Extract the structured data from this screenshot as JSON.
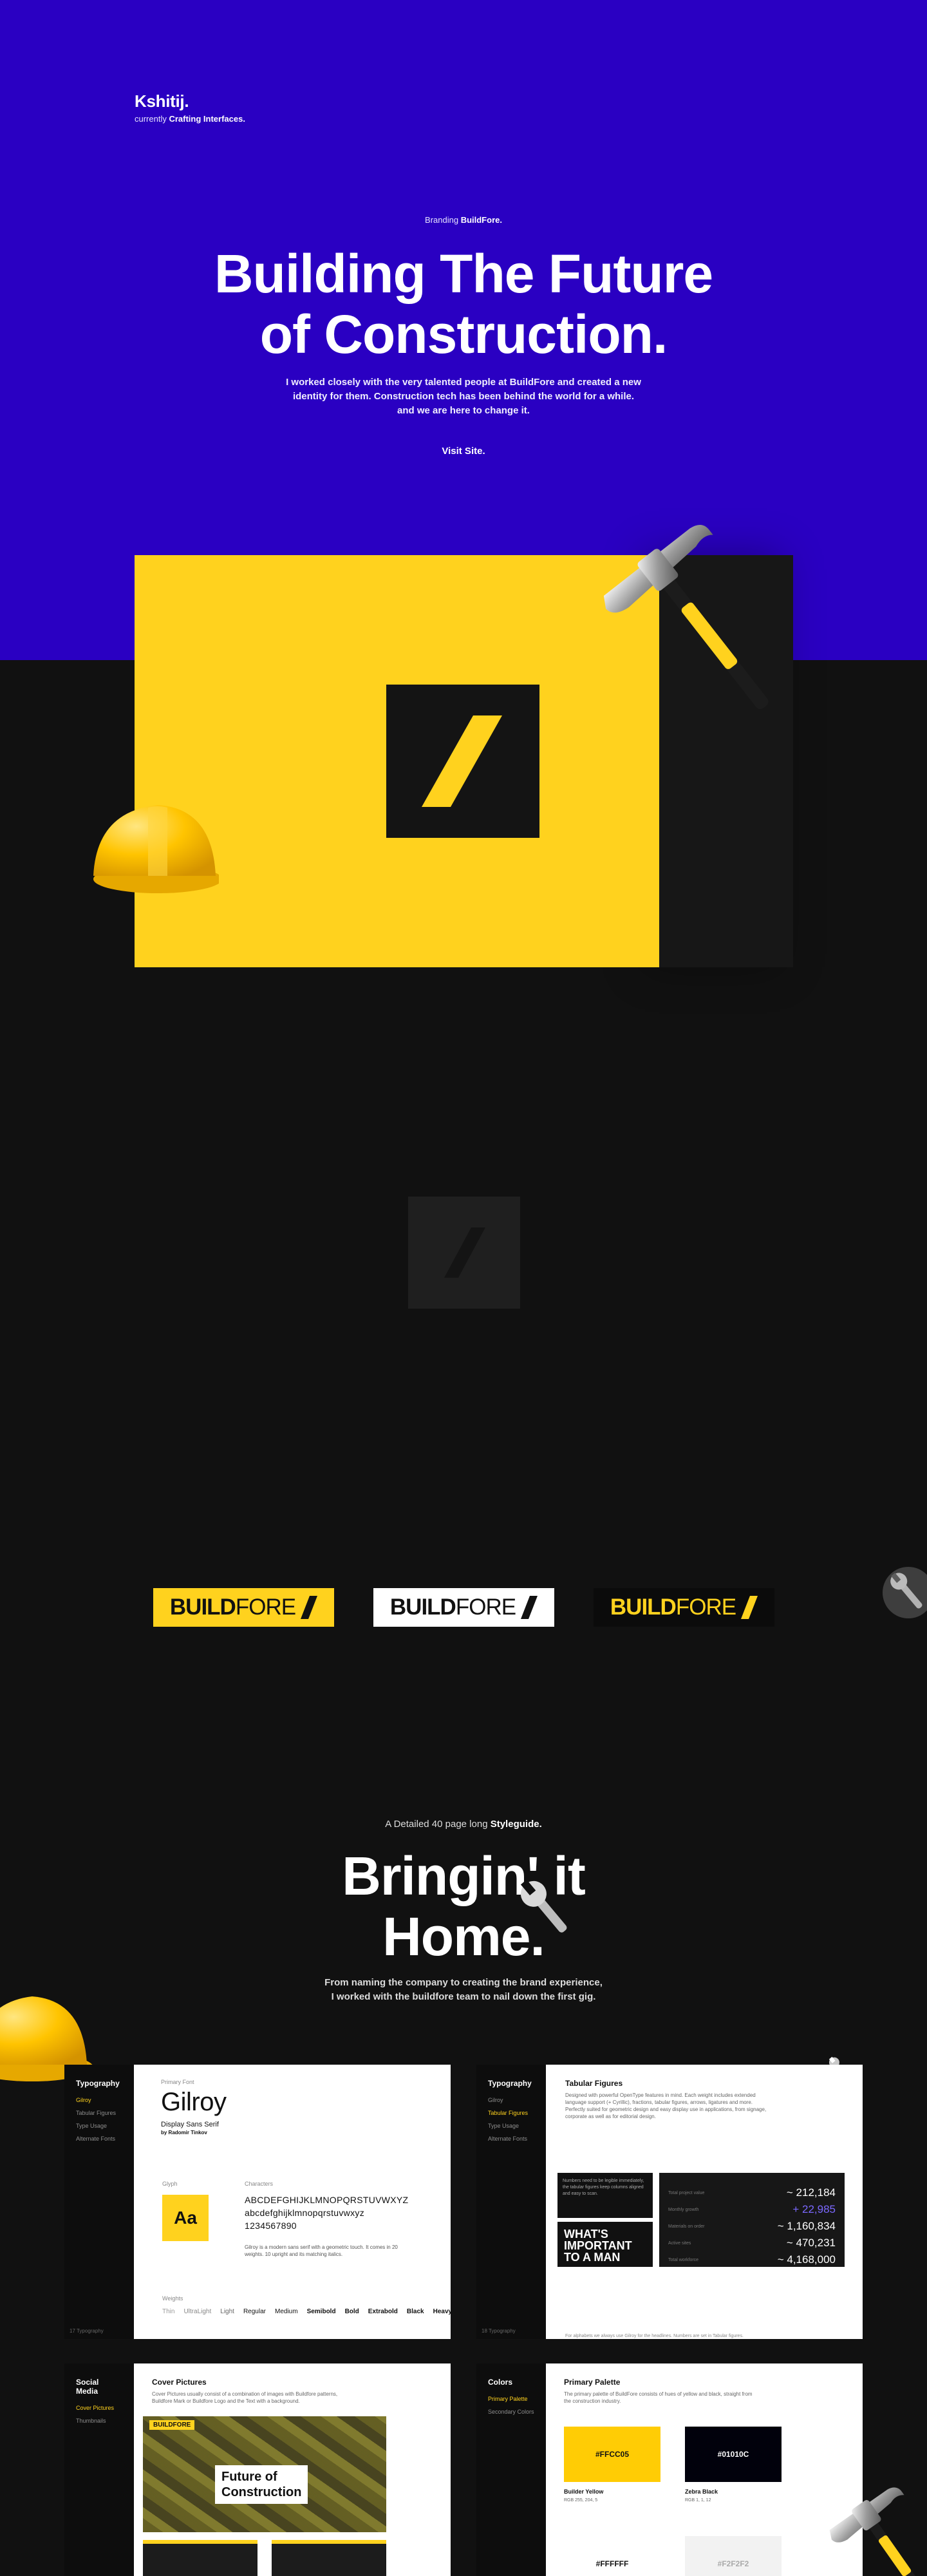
{
  "header": {
    "brand": "Kshitij.",
    "tagline_prefix": "currently ",
    "tagline_bold": "Crafting Interfaces."
  },
  "hero": {
    "eyebrow_prefix": "Branding ",
    "eyebrow_bold": "BuildFore.",
    "title_line1": "Building The Future",
    "title_line2": "of Construction.",
    "desc_line1": "I worked closely with the very talented people at BuildFore and created a new",
    "desc_line2": "identity for them. Construction tech has been behind the world for a while.",
    "desc_line3": "and we are here to change it.",
    "visit": "Visit Site."
  },
  "logos": {
    "word_bold": "BUILD",
    "word_light": "FORE"
  },
  "styleguide": {
    "eyebrow_prefix": "A Detailed 40 page long ",
    "eyebrow_bold": "Styleguide.",
    "title_line1": "Bringin' it",
    "title_line2": "Home.",
    "desc_line1": "From naming the company to creating the brand experience,",
    "desc_line2": "I worked with the buildfore team to nail down the first gig."
  },
  "card_typography": {
    "side_title": "Typography",
    "side_items": [
      "Gilroy",
      "Tabular Figures",
      "Type Usage",
      "Alternate Fonts"
    ],
    "foot": "17 Typography",
    "primary_font_label": "Primary Font",
    "font_name": "Gilroy",
    "font_desc": "Display Sans Serif",
    "font_author": "by Radomir Tinkov",
    "glyph_label": "Glyph",
    "glyph": "Aa",
    "chars_label": "Characters",
    "chars_upper": "ABCDEFGHIJKLMNOPQRSTUVWXYZ",
    "chars_lower": "abcdefghijklmnopqrstuvwxyz",
    "chars_num": "1234567890",
    "char_note": "Gilroy is a modern sans serif with a geometric touch. It comes in 20 weights. 10 upright and its matching italics.",
    "weights_label": "Weights",
    "weights": [
      "Thin",
      "UltraLight",
      "Light",
      "Regular",
      "Medium",
      "Semibold",
      "Bold",
      "Extrabold",
      "Black",
      "Heavy"
    ]
  },
  "card_tabular": {
    "side_title": "Typography",
    "side_items": [
      "Gilroy",
      "Tabular Figures",
      "Type Usage",
      "Alternate Fonts"
    ],
    "foot": "18 Typography",
    "title": "Tabular Figures",
    "text": "Designed with powerful OpenType features in mind. Each weight includes extended language support (+ Cyrillic), fractions, tabular figures, arrows, ligatures and more. Perfectly suited for geometric design and easy display use in applications, from signage, corporate as well as for editorial design.",
    "box1_text": "Numbers need to be legible immediately, the tabular figures keep columns aligned and easy to scan.",
    "box2_line1": "WHAT'S",
    "box2_line2": "IMPORTANT",
    "box2_line3": "TO A MAN",
    "rows": [
      {
        "label": "Total project value",
        "value": "~ 212,184"
      },
      {
        "label": "Monthly growth",
        "value": "+ 22,985"
      },
      {
        "label": "Materials on order",
        "value": "~ 1,160,834"
      },
      {
        "label": "Active sites",
        "value": "~ 470,231"
      },
      {
        "label": "Total workforce",
        "value": "~ 4,168,000"
      }
    ],
    "foot_note": "For alphabets we always use Gilroy for the headlines. Numbers are set in Tabular figures."
  },
  "card_social": {
    "side_title": "Social Media",
    "side_items": [
      "Cover Pictures",
      "Thumbnails"
    ],
    "title": "Cover Pictures",
    "text": "Cover Pictures usually consist of a combination of images with Buildfore patterns, Buildfore Mark or Buildfore Logo and the Text with a background.",
    "tag": "BUILDFORE",
    "head_line1": "Future of",
    "head_line2": "Construction"
  },
  "card_colors": {
    "side_title": "Colors",
    "side_items": [
      "Primary Palette",
      "Secondary Colors"
    ],
    "title": "Primary Palette",
    "text": "The primary palette of BuildFore consists of hues of yellow and black, straight from the construction industry.",
    "swatches": [
      {
        "hex": "#FFCC05",
        "name": "Builder Yellow",
        "meta": "RGB 255, 204, 5"
      },
      {
        "hex": "#01010C",
        "name": "Zebra Black",
        "meta": "RGB 1, 1, 12"
      },
      {
        "hex": "#FFFFFF",
        "name": "",
        "meta": ""
      },
      {
        "hex": "#F2F2F2",
        "name": "",
        "meta": ""
      }
    ]
  },
  "colors": {
    "hero_bg": "#2a00c2",
    "page_bg": "#111111",
    "brand_yellow": "#ffd21e"
  }
}
